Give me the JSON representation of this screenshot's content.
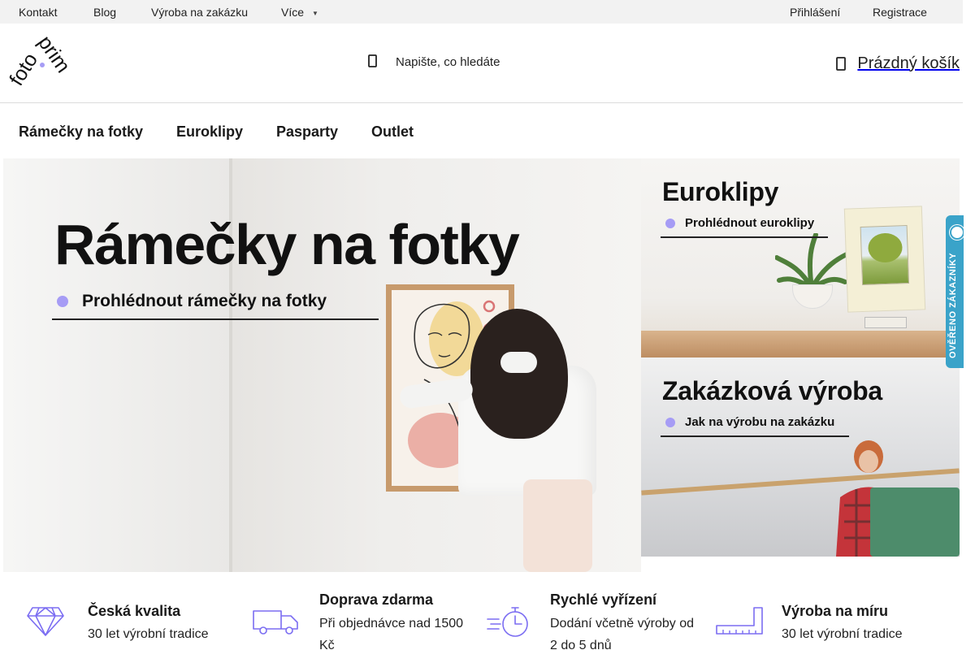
{
  "topbar": {
    "links": [
      "Kontakt",
      "Blog",
      "Výroba na zakázku",
      "Více"
    ],
    "auth": [
      "Přihlášení",
      "Registrace"
    ]
  },
  "header": {
    "logo_text": "fotoprim",
    "search": {
      "placeholder": "Napište, co hledáte",
      "icon": "search-icon"
    },
    "cart": {
      "label": "Prázdný košík",
      "icon": "cart-icon"
    }
  },
  "nav": {
    "items": [
      "Rámečky na fotky",
      "Euroklipy",
      "Pasparty",
      "Outlet"
    ]
  },
  "hero": {
    "main": {
      "title": "Rámečky na fotky",
      "link": "Prohlédnout rámečky na fotky"
    },
    "side1": {
      "title": "Euroklipy",
      "link": "Prohlédnout euroklipy"
    },
    "side2": {
      "title": "Zakázková výroba",
      "link": "Jak na výrobu na zakázku"
    }
  },
  "badge": {
    "text": "OVĚŘENO ZÁKAZNÍKY"
  },
  "benefits": [
    {
      "icon": "diamond-icon",
      "title": "Česká kvalita",
      "text": "30 let výrobní tradice"
    },
    {
      "icon": "truck-icon",
      "title": "Doprava zdarma",
      "text": "Při objednávce nad 1500 Kč"
    },
    {
      "icon": "stopwatch-icon",
      "title": "Rychlé vyřízení",
      "text": "Dodání včetně výroby od 2 do 5 dnů"
    },
    {
      "icon": "ruler-icon",
      "title": "Výroba na míru",
      "text": "30 let výrobní tradice"
    }
  ],
  "colors": {
    "accent": "#a69cf5",
    "icon": "#7b6df2",
    "badge": "#3aa3c9"
  }
}
